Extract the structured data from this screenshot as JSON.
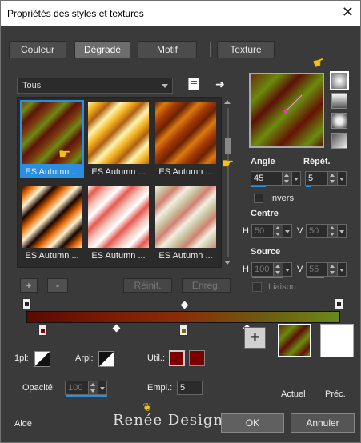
{
  "window": {
    "title": "Propriétés des styles et textures",
    "close_label": "✕"
  },
  "tabs": [
    {
      "label": "Couleur"
    },
    {
      "label": "Dégradé"
    },
    {
      "label": "Motif"
    },
    {
      "label": "Texture"
    }
  ],
  "category": {
    "value": "Tous"
  },
  "gallery": [
    {
      "label": "ES Autumn ...",
      "colors": [
        "#7a3a10",
        "#6e8a14",
        "#5e1409"
      ]
    },
    {
      "label": "ES Autumn ...",
      "colors": [
        "#fff3b0",
        "#f0b020",
        "#b06010"
      ]
    },
    {
      "label": "ES Autumn ...",
      "colors": [
        "#6b2205",
        "#d97a10",
        "#a53a06"
      ]
    },
    {
      "label": "ES Autumn ...",
      "colors": [
        "#1a0400",
        "#e86a08",
        "#fff2d0"
      ]
    },
    {
      "label": "ES Autumn ...",
      "colors": [
        "#ffffff",
        "#e45a50",
        "#f4c0b8"
      ]
    },
    {
      "label": "ES Autumn ...",
      "colors": [
        "#f2eee0",
        "#c9c3a0",
        "#d08070"
      ]
    }
  ],
  "buttons": {
    "add": "+",
    "remove": "-",
    "reset": "Réinit.",
    "save": "Enreg.",
    "ok": "OK",
    "cancel": "Annuler",
    "help": "Aide",
    "add_color": "+"
  },
  "fields": {
    "angle_label": "Angle",
    "angle_value": "45",
    "repeat_label": "Répét.",
    "repeat_value": "5",
    "invert_label": "Invers",
    "center_label": "Centre",
    "center_h_label": "H",
    "center_h": "50",
    "center_v_label": "V",
    "center_v": "50",
    "source_label": "Source",
    "source_h_label": "H",
    "source_h": "100",
    "source_v_label": "V",
    "source_v": "55",
    "link_label": "Liaison",
    "plan1_label": "1pl:",
    "arrplan_label": "Arpl:",
    "util_label": "Util.:",
    "opacity_label": "Opacité:",
    "opacity_value": "100",
    "empl_label": "Empl.:",
    "empl_value": "5",
    "current_label": "Actuel",
    "previous_label": "Préc."
  },
  "gradient_stops": [
    {
      "color": "#5a0a00",
      "pos": 0.05
    },
    {
      "color": "#6e5a10",
      "pos": 0.5
    },
    {
      "color": "#6a8a1a",
      "pos": 0.9
    }
  ],
  "brand": "Renée Design",
  "icons": {
    "hand": "pointing-hand-icon",
    "butterfly": "butterfly-icon"
  }
}
